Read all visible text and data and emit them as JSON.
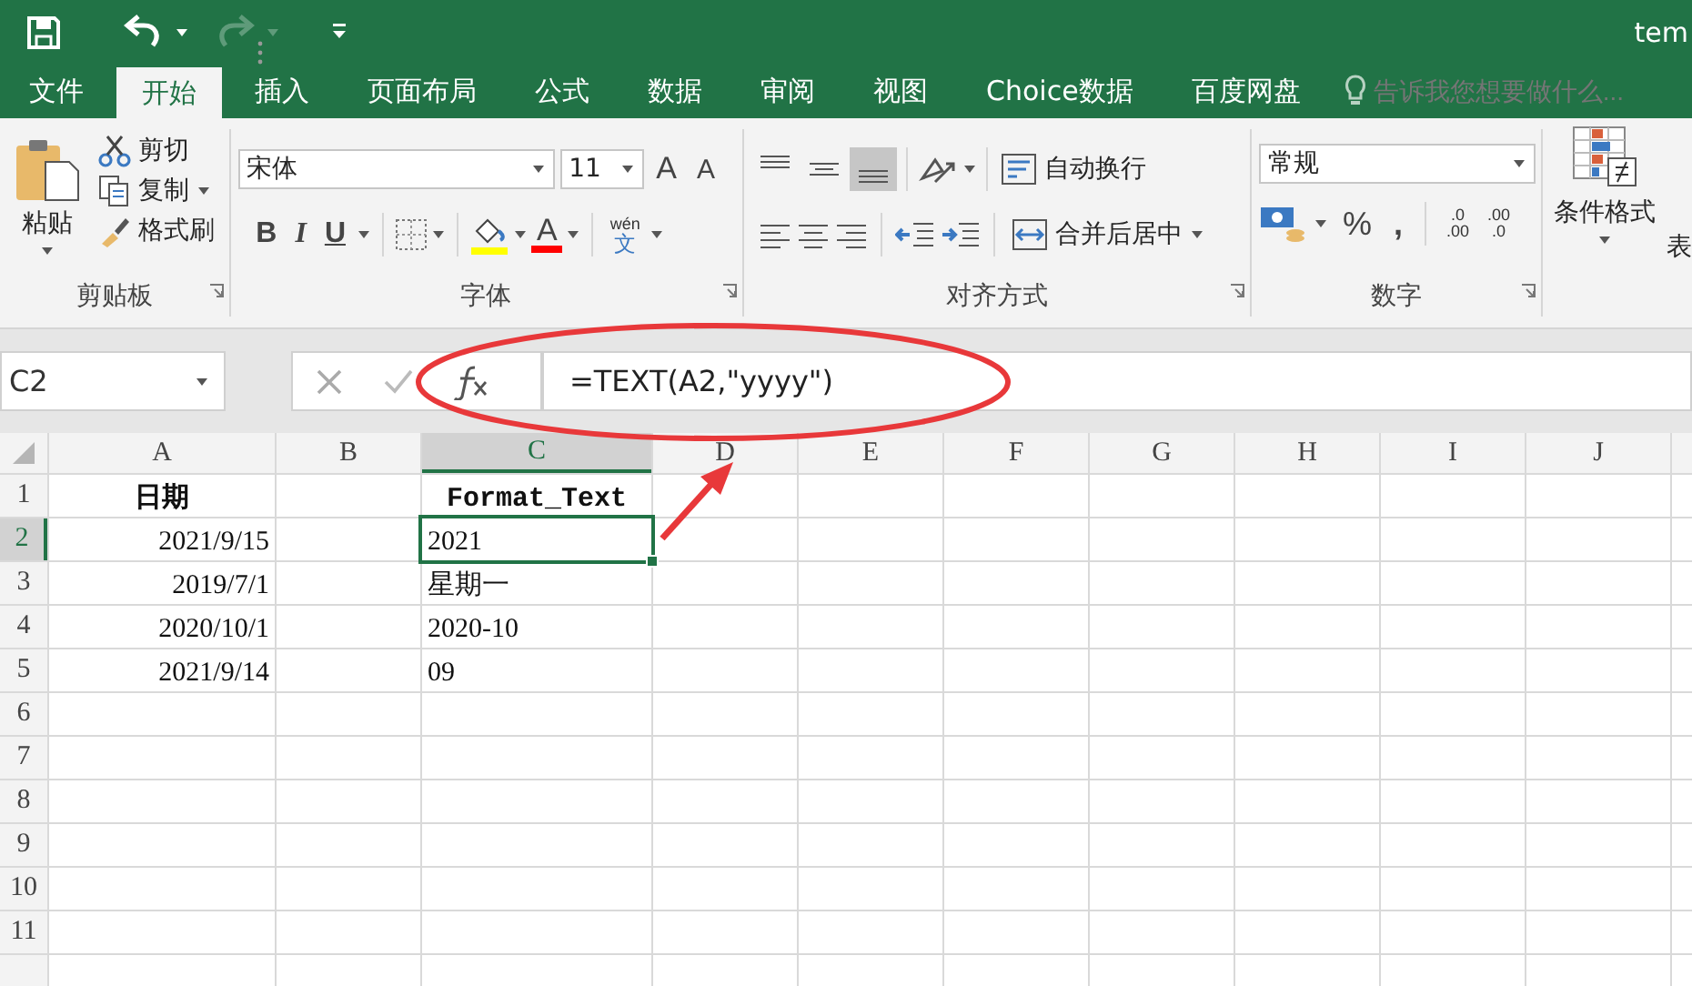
{
  "window": {
    "title": "tem"
  },
  "tabs": [
    {
      "label": "文件",
      "selected": false
    },
    {
      "label": "开始",
      "selected": true
    },
    {
      "label": "插入",
      "selected": false
    },
    {
      "label": "页面布局",
      "selected": false
    },
    {
      "label": "公式",
      "selected": false
    },
    {
      "label": "数据",
      "selected": false
    },
    {
      "label": "审阅",
      "selected": false
    },
    {
      "label": "视图",
      "selected": false
    },
    {
      "label": "Choice数据",
      "selected": false
    },
    {
      "label": "百度网盘",
      "selected": false
    }
  ],
  "tell_me": {
    "placeholder": "告诉我您想要做什么..."
  },
  "ribbon": {
    "clipboard": {
      "paste": "粘贴",
      "cut": "剪切",
      "copy": "复制",
      "format_painter": "格式刷",
      "label": "剪贴板"
    },
    "font": {
      "name": "宋体",
      "size": "11",
      "grow": "A",
      "shrink": "A",
      "bold": "B",
      "italic": "I",
      "underline": "U",
      "font_color": "A",
      "phonetic": "wén",
      "phonetic_char": "文",
      "label": "字体"
    },
    "alignment": {
      "vertical": [
        {
          "kind": "top",
          "selected": false
        },
        {
          "kind": "middle",
          "selected": false
        },
        {
          "kind": "bottom",
          "selected": true
        }
      ],
      "wrap": "自动换行",
      "merge": "合并后居中",
      "label": "对齐方式"
    },
    "number": {
      "format": "常规",
      "percent": "%",
      "comma": ",",
      "increase_decimal": [
        ".0",
        ".00"
      ],
      "decrease_decimal": [
        ".00",
        ".0"
      ],
      "label": "数字"
    },
    "styles": {
      "conditional": "条件格式",
      "next": "表"
    }
  },
  "formula_bar": {
    "name_box": "C2",
    "formula": "=TEXT(A2,\"yyyy\")"
  },
  "sheet": {
    "columns": [
      {
        "label": "A",
        "selected": false
      },
      {
        "label": "B",
        "selected": false
      },
      {
        "label": "C",
        "selected": true
      },
      {
        "label": "D",
        "selected": false
      },
      {
        "label": "E",
        "selected": false
      },
      {
        "label": "F",
        "selected": false
      },
      {
        "label": "G",
        "selected": false
      },
      {
        "label": "H",
        "selected": false
      },
      {
        "label": "I",
        "selected": false
      },
      {
        "label": "J",
        "selected": false
      }
    ],
    "rows": [
      {
        "label": "1",
        "selected": false,
        "kind": "header",
        "column_a": "日期",
        "column_c": "Format_Text"
      },
      {
        "label": "2",
        "selected": true,
        "kind": "data",
        "column_a": "2021/9/15",
        "column_c": "2021"
      },
      {
        "label": "3",
        "selected": false,
        "kind": "data",
        "column_a": "2019/7/1",
        "column_c": "星期一"
      },
      {
        "label": "4",
        "selected": false,
        "kind": "data",
        "column_a": "2020/10/1",
        "column_c": "2020-10"
      },
      {
        "label": "5",
        "selected": false,
        "kind": "data",
        "column_a": "2021/9/14",
        "column_c": "09"
      },
      {
        "label": "6",
        "selected": false,
        "kind": "data"
      },
      {
        "label": "7",
        "selected": false,
        "kind": "data"
      },
      {
        "label": "8",
        "selected": false,
        "kind": "data"
      },
      {
        "label": "9",
        "selected": false,
        "kind": "data"
      },
      {
        "label": "10",
        "selected": false,
        "kind": "data"
      },
      {
        "label": "11",
        "selected": false,
        "kind": "data"
      }
    ]
  },
  "annotations": [
    {
      "kind": "ellipse"
    },
    {
      "kind": "arrow"
    }
  ]
}
